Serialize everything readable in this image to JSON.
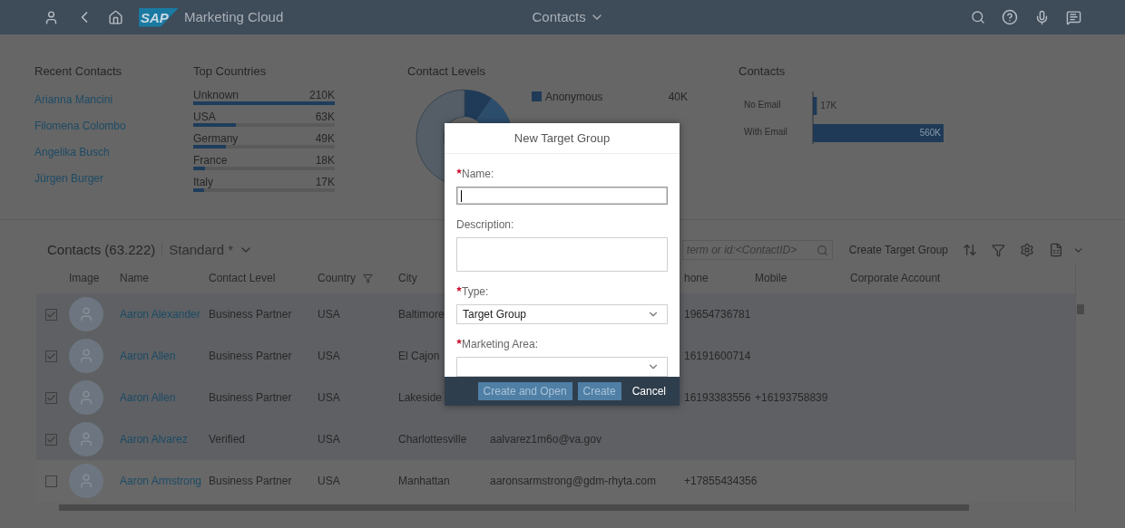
{
  "header": {
    "logo": "SAP",
    "app_title": "Marketing Cloud",
    "page_title": "Contacts"
  },
  "recent_contacts": {
    "title": "Recent Contacts",
    "items": [
      "Arianna Mancini",
      "Filomena Colombo",
      "Angelika Busch",
      "Jürgen Burger"
    ]
  },
  "top_countries": {
    "title": "Top Countries",
    "items": [
      {
        "name": "Unknown",
        "value": "210K",
        "level": 1
      },
      {
        "name": "USA",
        "value": "63K",
        "level": 0.3
      },
      {
        "name": "Germany",
        "value": "49K",
        "level": 0.23
      },
      {
        "name": "France",
        "value": "18K",
        "level": 0.086
      },
      {
        "name": "Italy",
        "value": "17K",
        "level": 0.08
      }
    ]
  },
  "contact_levels": {
    "title": "Contact Levels",
    "legend": [
      {
        "label": "Anonymous",
        "value": "40K",
        "color": "#1f3b57"
      }
    ]
  },
  "contacts_chart": {
    "chart_data": {
      "type": "bar",
      "orientation": "horizontal",
      "title": "Contacts",
      "categories": [
        "No Email",
        "With Email"
      ],
      "values": [
        17000,
        560000
      ],
      "value_labels": [
        "17K",
        "560K"
      ]
    }
  },
  "table": {
    "title": "Contacts (63.222)",
    "variant": "Standard *",
    "search": {
      "placeholder": "term or id:<ContactID>"
    },
    "create_button": "Create Target Group",
    "columns": [
      {
        "label": "Image",
        "filtered": false
      },
      {
        "label": "Name",
        "filtered": false
      },
      {
        "label": "Contact Level",
        "filtered": false
      },
      {
        "label": "Country",
        "filtered": true
      },
      {
        "label": "City",
        "filtered": false
      },
      {
        "label": "hone",
        "filtered": false
      },
      {
        "label": "Mobile",
        "filtered": false
      },
      {
        "label": "Corporate Account",
        "filtered": false
      }
    ],
    "rows": [
      {
        "checked": true,
        "name": "Aaron Alexander",
        "contact_level": "Business Partner",
        "country": "USA",
        "city": "Baltimore",
        "phone": "19654736781"
      },
      {
        "checked": true,
        "name": "Aaron Allen",
        "contact_level": "Business Partner",
        "country": "USA",
        "city": "El Cajon",
        "phone": "16191600714"
      },
      {
        "checked": true,
        "name": "Aaron Allen",
        "contact_level": "Business Partner",
        "country": "USA",
        "city": "Lakeside",
        "phone": "16193383556",
        "mobile": "+16193758839"
      },
      {
        "checked": true,
        "name": "Aaron Alvarez",
        "contact_level": "Verified",
        "country": "USA",
        "city": "Charlottesville",
        "email": "aalvarez1m6o@va.gov"
      },
      {
        "checked": false,
        "name": "Aaron Armstrong",
        "contact_level": "Business Partner",
        "country": "USA",
        "city": "Manhattan",
        "email": "aaronsarmstrong@gdm-rhyta.com",
        "phone": "+17855434356"
      }
    ]
  },
  "dialog": {
    "title": "New Target Group",
    "fields": [
      {
        "kind": "input",
        "label": "Name:",
        "required": true,
        "focused": true
      },
      {
        "kind": "textarea",
        "label": "Description:",
        "required": false,
        "focused": false
      },
      {
        "kind": "select",
        "label": "Type:",
        "required": true,
        "value": "Target Group",
        "focused": false
      },
      {
        "kind": "select",
        "label": "Marketing Area:",
        "required": true,
        "focused": false
      }
    ],
    "buttons": [
      {
        "label": "Create and Open",
        "kind": "primary",
        "disabled": true
      },
      {
        "label": "Create",
        "kind": "primary",
        "disabled": true
      },
      {
        "label": "Cancel",
        "kind": "plain",
        "disabled": false
      }
    ]
  }
}
